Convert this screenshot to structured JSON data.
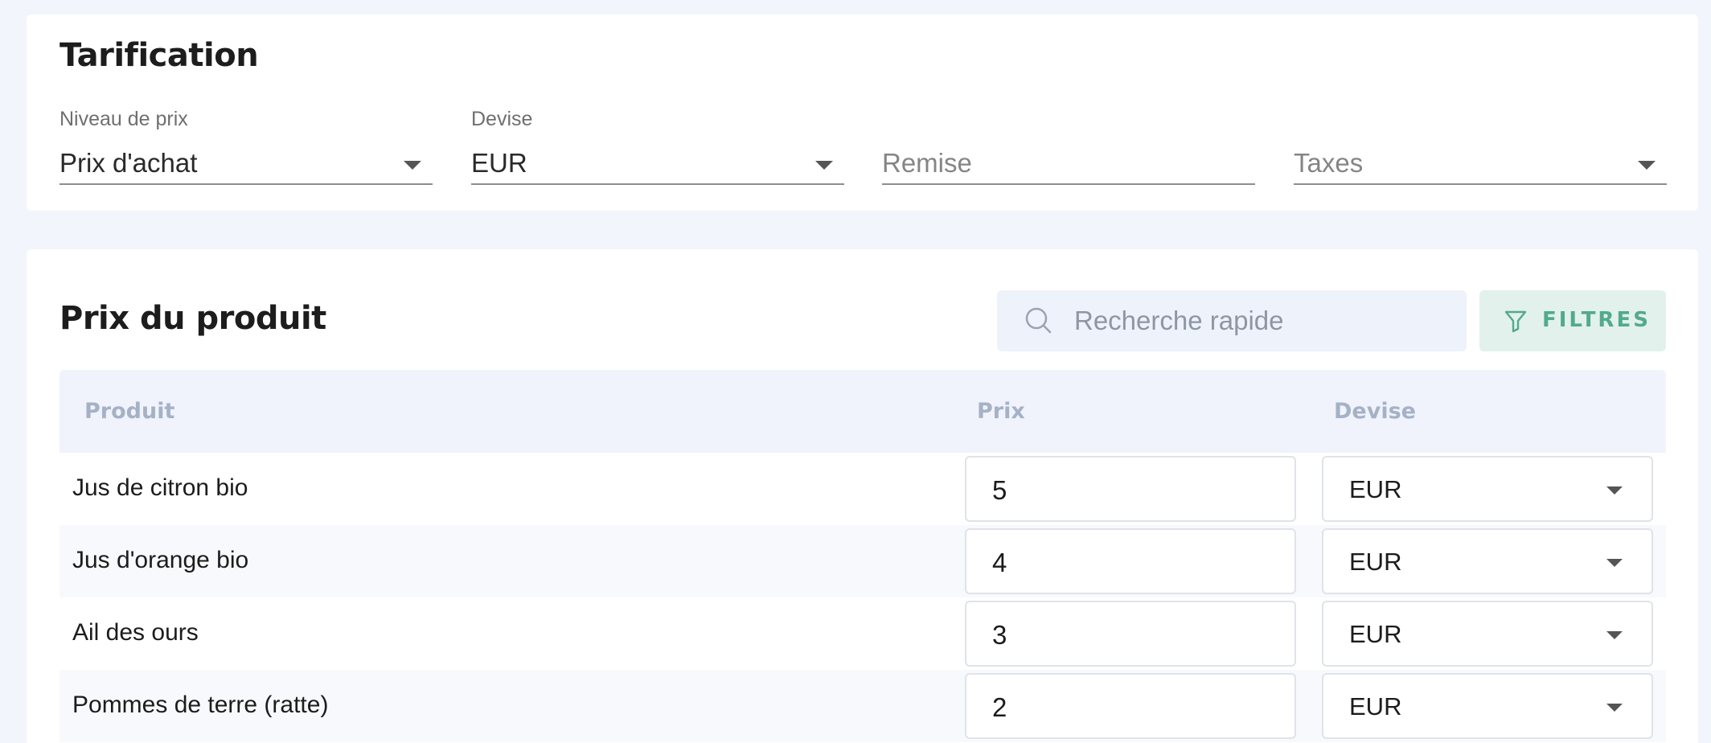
{
  "pricing": {
    "title": "Tarification",
    "fields": [
      {
        "label": "Niveau de prix",
        "value": "Prix d'achat",
        "placeholder": "",
        "dropdown": true
      },
      {
        "label": "Devise",
        "value": "EUR",
        "placeholder": "",
        "dropdown": true
      },
      {
        "label": "",
        "value": "",
        "placeholder": "Remise",
        "dropdown": false
      },
      {
        "label": "",
        "value": "",
        "placeholder": "Taxes",
        "dropdown": true
      }
    ]
  },
  "product_prices": {
    "title": "Prix du produit",
    "search": {
      "placeholder": "Recherche rapide",
      "icon": "search-icon"
    },
    "filter_button": {
      "label": "FILTRES",
      "icon": "filter-icon",
      "color": "#52aa8c"
    },
    "columns": {
      "product": "Produit",
      "price": "Prix",
      "currency": "Devise"
    },
    "rows": [
      {
        "product": "Jus de citron bio",
        "price": "5",
        "currency": "EUR"
      },
      {
        "product": "Jus d'orange bio",
        "price": "4",
        "currency": "EUR"
      },
      {
        "product": "Ail des ours",
        "price": "3",
        "currency": "EUR"
      },
      {
        "product": "Pommes de terre (ratte)",
        "price": "2",
        "currency": "EUR"
      }
    ]
  },
  "colors": {
    "background": "#f2f5fb",
    "card": "#ffffff",
    "accent": "#52aa8c",
    "table_header": "#f0f3fb"
  }
}
